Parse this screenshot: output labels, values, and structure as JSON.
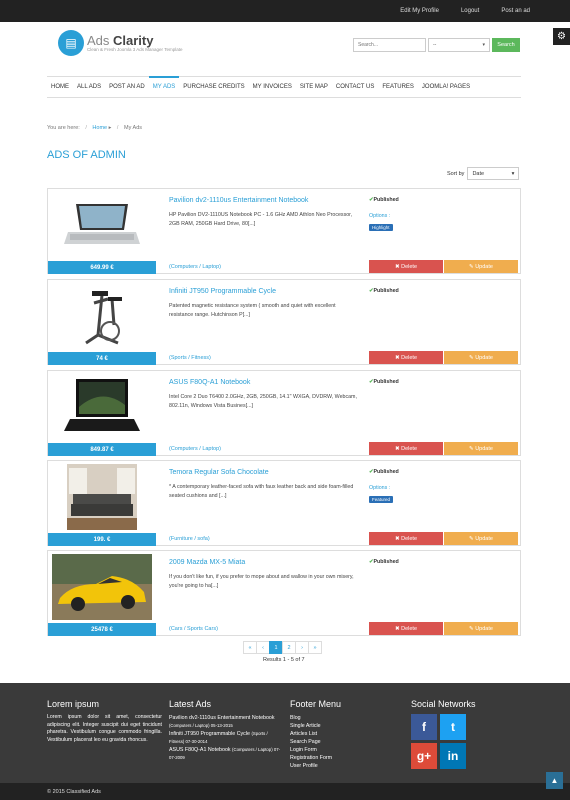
{
  "topbar": {
    "links": [
      "Edit My Profile",
      "Logout",
      "Post an ad"
    ]
  },
  "logo": {
    "title_a": "Ads ",
    "title_b": "Clarity",
    "subtitle": "Clean & Fresh Joomla 3 Ads Manager Template"
  },
  "search": {
    "placeholder": "Search...",
    "select_value": "--",
    "button": "Search"
  },
  "nav": {
    "items": [
      "HOME",
      "ALL ADS",
      "POST AN AD",
      "MY ADS",
      "PURCHASE CREDITS",
      "MY INVOICES",
      "SITE MAP",
      "CONTACT US",
      "FEATURES",
      "JOOMLA! PAGES"
    ],
    "active": "MY ADS"
  },
  "breadcrumb": {
    "prefix": "You are here:",
    "home": "Home",
    "current": "My Ads"
  },
  "page_title": "ADS OF ADMIN",
  "sort": {
    "label": "Sort by",
    "value": "Date"
  },
  "ads": [
    {
      "title": "Pavilion dv2-1110us Entertainment Notebook",
      "desc": "HP Pavilion DV2-1110US Notebook PC - 1.6 GHz AMD Athlon Neo Processor, 2GB RAM, 250GB Hard Drive, 80[...]",
      "price": "649.99 €",
      "category": "(Computers / Laptop)",
      "status": "Published",
      "options": "Options :",
      "badge": "Highlight",
      "image": "laptop-image"
    },
    {
      "title": "Infiniti JT950 Programmable Cycle",
      "desc": "Patented magnetic resistance system ( smooth and quiet with excellent resistance range. Hutchinson P[...]",
      "price": "74 €",
      "category": "(Sports / Fitness)",
      "status": "Published",
      "options": "",
      "badge": "",
      "image": "cycle-image"
    },
    {
      "title": "ASUS F80Q-A1 Notebook",
      "desc": "Intel Core 2 Duo T6400 2.0GHz, 2GB, 250GB, 14.1\" WXGA, DVDRW, Webcam, 802.11n, Windows Vista Busines[...]",
      "price": "849.87 €",
      "category": "(Computers / Laptop)",
      "status": "Published",
      "options": "",
      "badge": "",
      "image": "notebook-image"
    },
    {
      "title": "Temora Regular Sofa Chocolate",
      "desc": "* A contemporary leather-faced sofa with faux leather back and side foam-filled seated cushions and [...]",
      "price": "199. €",
      "category": "(Furniture / sofa)",
      "status": "Published",
      "options": "Options :",
      "badge": "Featured",
      "image": "sofa-image"
    },
    {
      "title": "2009 Mazda MX-5 Miata",
      "desc": "If you don't like fun, if you prefer to mope about and wallow in your own misery, you're going to ha[...]",
      "price": "25478 €",
      "category": "(Cars / Sports Cars)",
      "status": "Published",
      "options": "",
      "badge": "",
      "image": "car-image"
    }
  ],
  "actions": {
    "delete": "Delete",
    "update": "Update"
  },
  "pager": {
    "first": "«",
    "prev": "‹",
    "p1": "1",
    "p2": "2",
    "next": "›",
    "last": "»"
  },
  "results": "Results 1 - 5 of 7",
  "footer": {
    "col1_title": "Lorem ipsum",
    "col1_text": "Lorem ipsum dolor sit amet, consectetur adipiscing elit. Integer suscipit dui eget tincidunt pharetra. Vestibulum congue commodo fringilla. Vestibulum placerat leo eu gravida rhoncus.",
    "col2_title": "Latest Ads",
    "latest": [
      {
        "title": "Pavilion dv2-1110us Entertainment Notebook",
        "meta": "(Computers / Laptop) 05-13-2015"
      },
      {
        "title": "Infiniti JT950 Programmable Cycle",
        "meta": "(Sports / Fitness) 07-30-2014"
      },
      {
        "title": "ASUS F80Q-A1 Notebook",
        "meta": "(Computers / Laptop) 07-07-2009"
      }
    ],
    "col3_title": "Footer Menu",
    "menu": [
      "Blog",
      "Single Article",
      "Articles List",
      "Search Page",
      "Login Form",
      "Registration Form",
      "User Profile"
    ],
    "col4_title": "Social Networks",
    "social": [
      "f",
      "t",
      "g+",
      "in"
    ],
    "copyright": "© 2015 Classified Ads"
  },
  "colors": {
    "accent": "#2a9fd6",
    "delete": "#d9534f",
    "update": "#f0ad4e",
    "search_btn": "#5cb85c"
  }
}
